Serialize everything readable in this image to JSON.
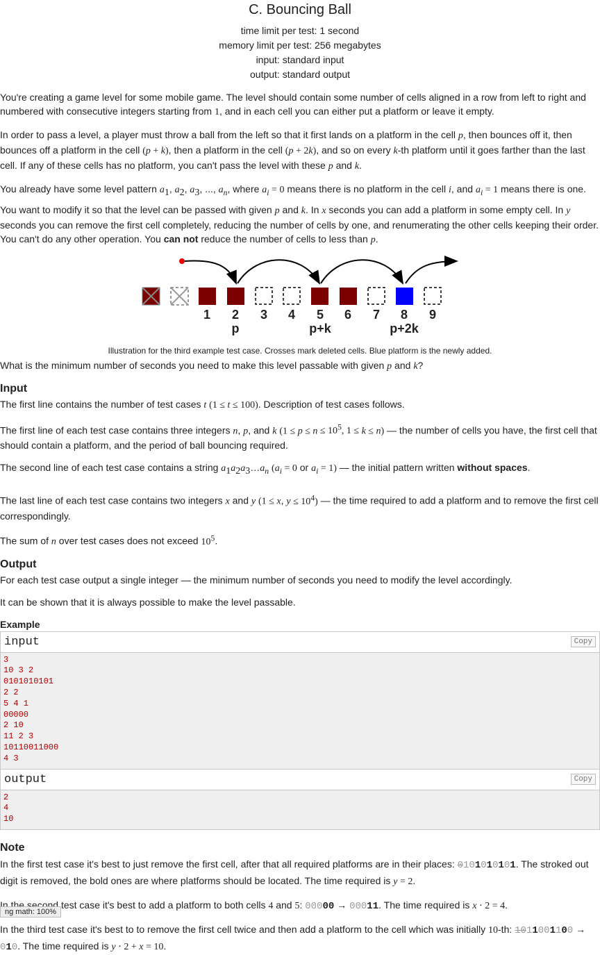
{
  "problem": {
    "title": "C. Bouncing Ball",
    "time_limit": "time limit per test: 1 second",
    "memory_limit": "memory limit per test: 256 megabytes",
    "input": "input: standard input",
    "output": "output: standard output"
  },
  "figure": {
    "cells": [
      "1",
      "2",
      "3",
      "4",
      "5",
      "6",
      "7",
      "8",
      "9"
    ],
    "labels": [
      "p",
      "p+k",
      "p+2k"
    ],
    "caption": "Illustration for the third example test case. Crosses mark deleted cells. Blue platform is the newly added."
  },
  "sections": {
    "input": "Input",
    "output": "Output",
    "example": "Example",
    "note": "Note"
  },
  "example": {
    "input_label": "input",
    "output_label": "output",
    "copy": "Copy",
    "input_lines": [
      "3",
      "10 3 2",
      "0101010101",
      "2 2",
      "5 4 1",
      "00000",
      "2 10",
      "11 2 3",
      "10110011000",
      "4 3"
    ],
    "output_lines": [
      "2",
      "4",
      "10"
    ]
  },
  "zoom": "ng math: 100%"
}
